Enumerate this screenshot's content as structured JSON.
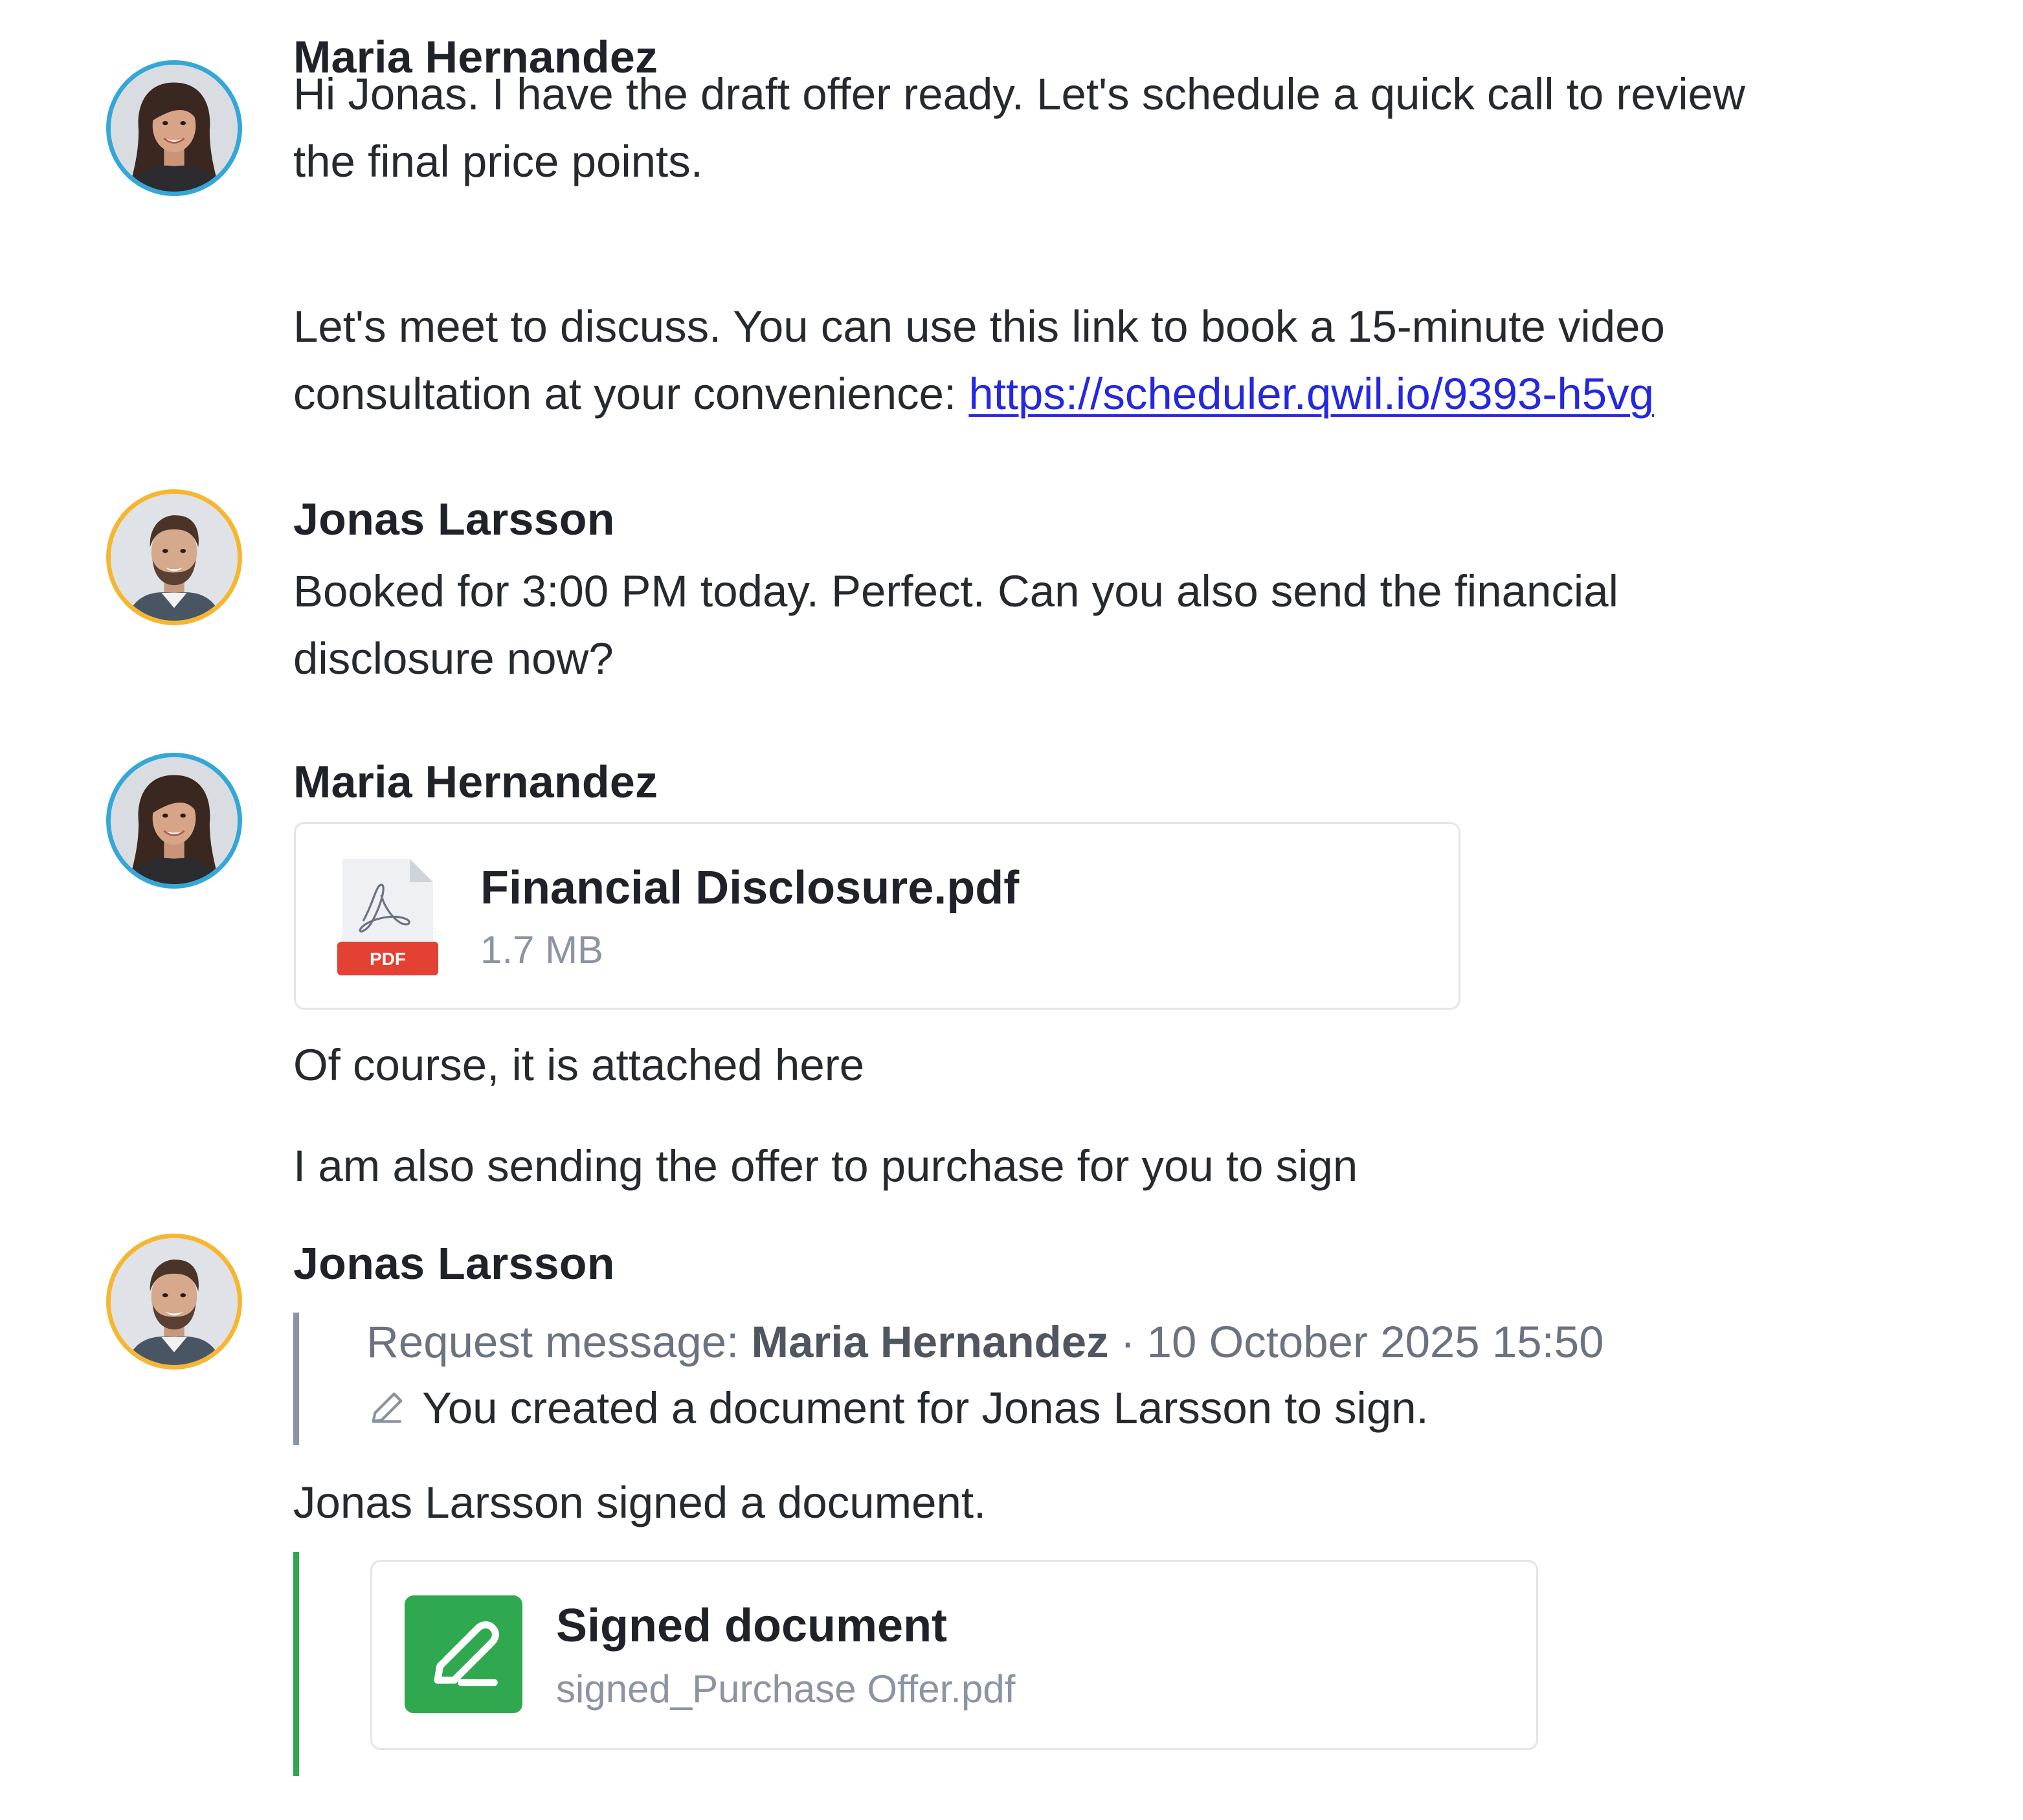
{
  "colors": {
    "maria_avatar_ring": "#35a7d6",
    "jonas_avatar_ring": "#f5b731",
    "link": "#2428e0",
    "signed_accent": "#2fa84f",
    "quote_bar": "#8a94a6",
    "pdf_badge": "#e34133"
  },
  "messages": [
    {
      "author": "Maria Hernandez",
      "avatar_icon": "avatar-maria-photo",
      "paragraphs": [
        [
          "Hi Jonas. I have the draft offer ready. Let's schedule a quick call to review",
          "the final price points."
        ],
        [
          "Let's meet to discuss. You can use this link to book a 15-minute video"
        ]
      ],
      "link_prefix": "consultation at your convenience: ",
      "link_text": "https://scheduler.qwil.io/9393-h5vg"
    },
    {
      "author": "Jonas Larsson",
      "avatar_icon": "avatar-jonas-photo",
      "paragraphs": [
        [
          "Booked for 3:00 PM today. Perfect. Can you also send the financial",
          "disclosure now?"
        ]
      ]
    },
    {
      "author": "Maria Hernandez",
      "avatar_icon": "avatar-maria-photo",
      "attachment": {
        "icon": "pdf-file-icon",
        "badge": "PDF",
        "name": "Financial Disclosure.pdf",
        "size": "1.7 MB"
      },
      "paragraphs": [
        [
          "Of course, it is attached here"
        ],
        [
          "I am also sending the offer to purchase for you to sign"
        ]
      ]
    },
    {
      "author": "Jonas Larsson",
      "avatar_icon": "avatar-jonas-photo",
      "quote": {
        "label": "Request message: ",
        "author": "Maria Hernandez",
        "separator": "·",
        "timestamp": "10 October 2025 15:50",
        "icon": "pen-icon",
        "text": "You created a document for Jonas Larsson to sign."
      },
      "status_text": "Jonas Larsson signed a document.",
      "signed_document": {
        "icon": "signature-pen-icon",
        "title": "Signed document",
        "filename": "signed_Purchase Offer.pdf"
      }
    }
  ]
}
